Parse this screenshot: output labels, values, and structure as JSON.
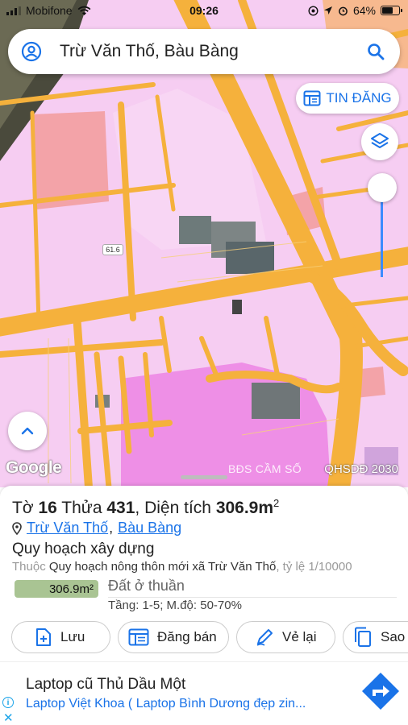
{
  "status_bar": {
    "carrier": "Mobifone",
    "time": "09:26",
    "battery": "64%",
    "battery_level": 0.64
  },
  "search": {
    "text": "Trừ Văn Thố, Bàu Bàng"
  },
  "map": {
    "post_button_label": "TIN ĐĂNG",
    "route_badge": "61.6",
    "google_label": "Google",
    "watermark": "BĐS CẦM SỐ",
    "plan_label": "QHSDĐ 2030"
  },
  "parcel": {
    "title_prefix": "Tờ",
    "sheet_no": "16",
    "plot_label": "Thửa",
    "plot_no": "431",
    "area_label": ", Diện tích",
    "area_value": "306.9m",
    "area_sup": "2",
    "location": {
      "commune": "Trừ Văn Thố",
      "separator": ",",
      "district": "Bàu Bàng"
    },
    "plan_type": "Quy hoạch xây dựng",
    "belongs_label": "Thuộc",
    "plan_name": "Quy hoạch nông thôn mới xã Trừ Văn Thố",
    "scale": ", tỷ lệ 1/10000",
    "area_badge": "306.9m²",
    "land_type": "Đất ở thuần",
    "floors": "Tầng: 1-5; M.độ: 50-70%",
    "colors": {
      "area_badge": "#a9c493"
    }
  },
  "actions": {
    "save": "Lưu",
    "post_sale": "Đăng bán",
    "redraw": "Vẻ lại",
    "copy": "Sao"
  },
  "ad": {
    "title": "Laptop cũ Thủ Dầu Một",
    "subtitle": "Laptop Việt Khoa ( Laptop Bình Dương đẹp zin...",
    "info_icon": "i",
    "close_icon": "✕"
  },
  "icons": {
    "account": "account-circle-icon",
    "search": "search-icon",
    "post": "post-listing-icon",
    "layers": "layers-icon",
    "up": "chevron-up-icon",
    "pin": "location-pin-icon",
    "save": "add-file-icon",
    "sale": "listing-icon",
    "redraw": "draw-icon",
    "copy": "copy-icon",
    "directions": "directions-icon"
  },
  "colors": {
    "accent": "#1a73e8",
    "map_pink": "#f6cdf2",
    "road": "#f5b13c"
  }
}
